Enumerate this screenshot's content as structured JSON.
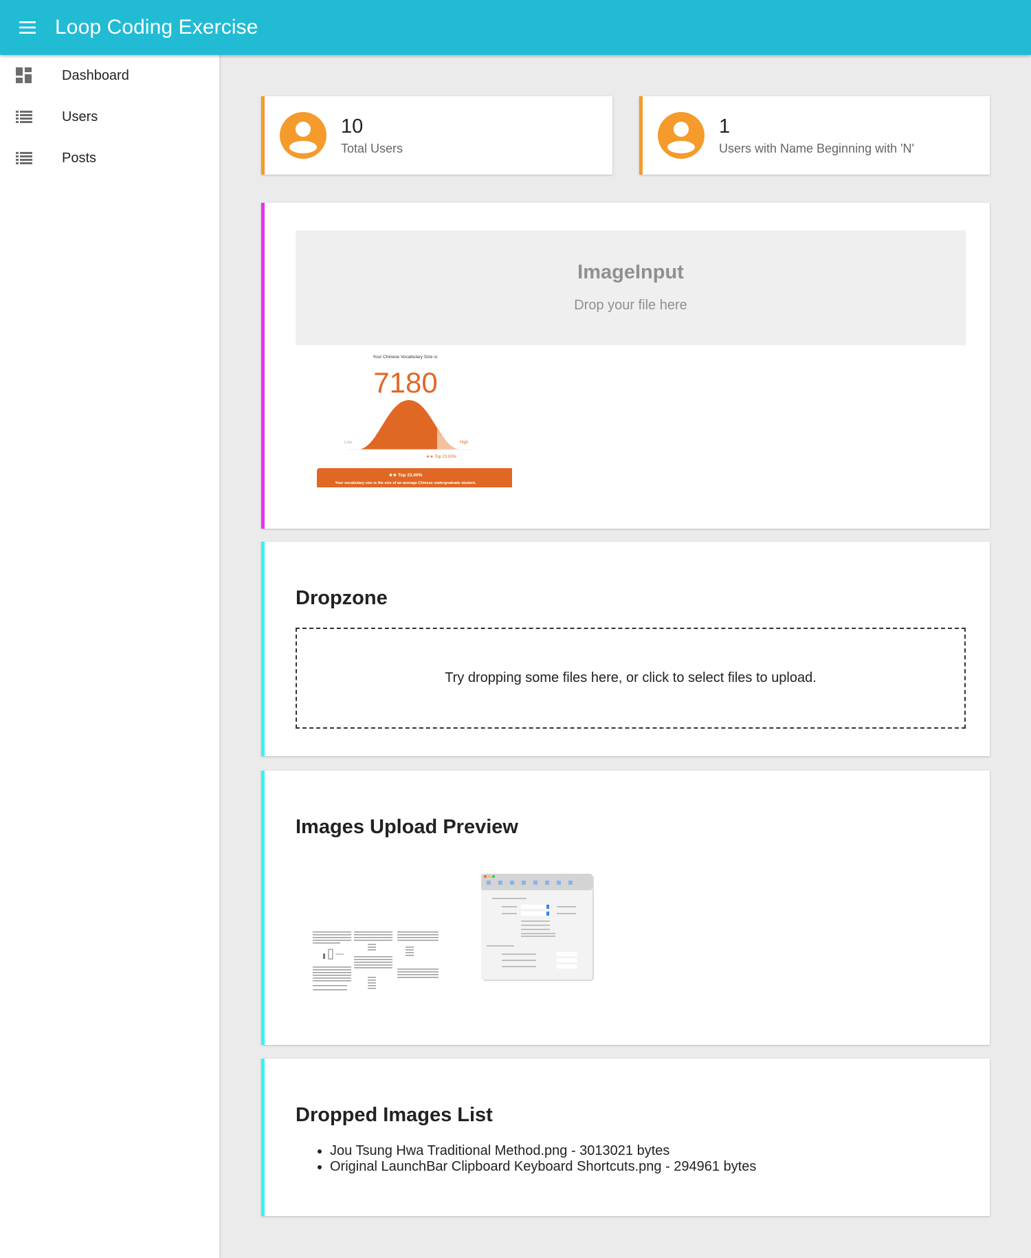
{
  "appbar": {
    "title": "Loop Coding Exercise",
    "menu_icon": "menu-icon"
  },
  "sidebar": {
    "items": [
      {
        "label": "Dashboard",
        "icon": "dashboard-icon"
      },
      {
        "label": "Users",
        "icon": "list-icon"
      },
      {
        "label": "Posts",
        "icon": "list-icon"
      }
    ]
  },
  "stats": [
    {
      "value": "10",
      "label": "Total Users",
      "icon": "account-circle-icon"
    },
    {
      "value": "1",
      "label": "Users with Name Beginning with 'N'",
      "icon": "account-circle-icon"
    }
  ],
  "image_input": {
    "title": "ImageInput",
    "subtitle": "Drop your file here",
    "preview": {
      "heading": "Your Chinese Vocabulary Size is:",
      "value": "7180",
      "low_label": "Low",
      "high_label": "High",
      "marker_label": "★★ Top 23.00%",
      "banner_line1": "★★ Top 23.00%",
      "banner_line2": "Your vocabulary size is the size of an average Chinese undergraduate student."
    }
  },
  "dropzone": {
    "title": "Dropzone",
    "prompt": "Try dropping some files here, or click to select files to upload."
  },
  "upload_preview": {
    "title": "Images Upload Preview"
  },
  "dropped_list": {
    "title": "Dropped Images List",
    "files": [
      "Jou Tsung Hwa Traditional Method.png - 3013021 bytes",
      "Original LaunchBar Clipboard Keyboard Shortcuts.png - 294961 bytes"
    ]
  },
  "colors": {
    "appbar": "#21bbd4",
    "stat_accent": "#f49b2c",
    "image_card_accent": "#e535ee",
    "cyan_accent": "#39f2f7",
    "vocab_orange": "#e06825"
  }
}
